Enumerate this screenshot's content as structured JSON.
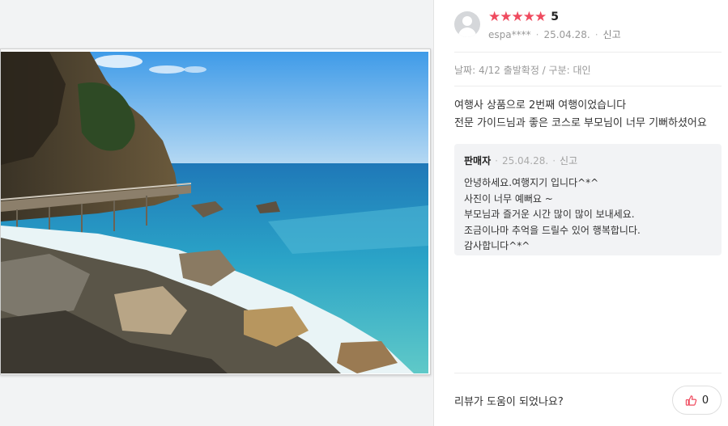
{
  "review": {
    "stars": [
      "★",
      "★",
      "★",
      "★",
      "★"
    ],
    "rating": "5",
    "reviewer": "espa****",
    "date": "25.04.28.",
    "report": "신고",
    "trip_info": "날짜: 4/12 출발확정 / 구분: 대인",
    "content_lines": [
      "여행사 상품으로 2번째 여행이었습니다",
      "전문 가이드님과 좋은 코스로 부모님이 너무 기뻐하셨어요"
    ]
  },
  "seller_reply": {
    "name": "판매자",
    "date": "25.04.28.",
    "report": "신고",
    "lines": [
      "안녕하세요.여행지기 입니다^*^",
      "사진이 너무 예뻐요 ~",
      "부모님과 즐거운 시간 많이 많이 보내세요.",
      "조금이나마 추억을 드릴수 있어 행복합니다.",
      "감사합니다^*^"
    ]
  },
  "helpful": {
    "question": "리뷰가 도움이 되었나요?",
    "count": "0"
  },
  "colors": {
    "star": "#ef4b5f",
    "like_icon": "#ef4b5f",
    "reply_bg": "#f2f3f5"
  },
  "icons": {
    "avatar": "default-user-avatar",
    "like": "thumbs-up-icon"
  }
}
